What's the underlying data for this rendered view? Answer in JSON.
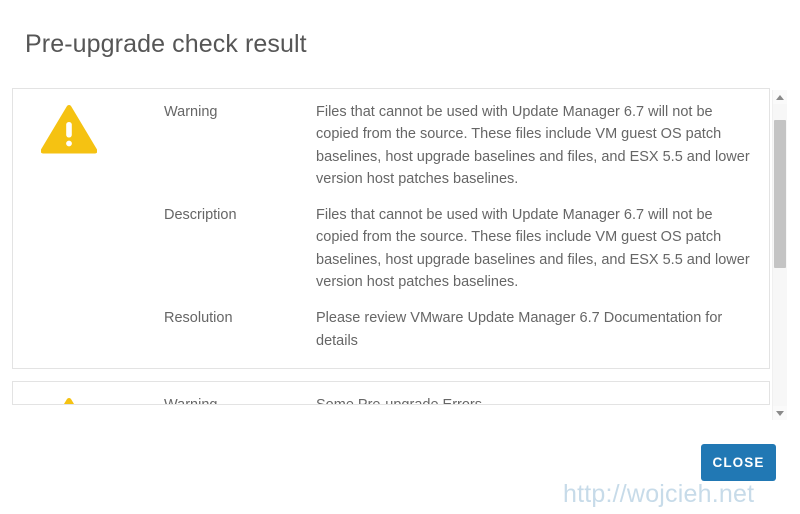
{
  "dialog": {
    "title": "Pre-upgrade check result",
    "close_label": "CLOSE"
  },
  "colors": {
    "accent": "#2178b4",
    "warning": "#f5c212",
    "text": "#666666",
    "card_border": "#e3e3e3",
    "watermark": "#c7dbe9"
  },
  "results": [
    {
      "icon": "warning-triangle-icon",
      "rows": [
        {
          "label": "Warning",
          "value": "Files that cannot be used with Update Manager 6.7 will not be copied from the source. These files include VM guest OS patch baselines, host upgrade baselines and files, and ESX 5.5 and lower version host patches baselines."
        },
        {
          "label": "Description",
          "value": "Files that cannot be used with Update Manager 6.7 will not be copied from the source. These files include VM guest OS patch baselines, host upgrade baselines and files, and ESX 5.5 and lower version host patches baselines."
        },
        {
          "label": "Resolution",
          "value": "Please review VMware Update Manager 6.7 Documentation for details"
        }
      ]
    },
    {
      "icon": "warning-triangle-icon",
      "rows": [
        {
          "label": "Warning",
          "value": "Some Pre-upgrade Errors"
        }
      ]
    }
  ],
  "scrollbar": {
    "up_arrow": "chevron-up-icon",
    "down_arrow": "chevron-down-icon"
  },
  "watermark": {
    "text": "http://wojcieh.net"
  }
}
